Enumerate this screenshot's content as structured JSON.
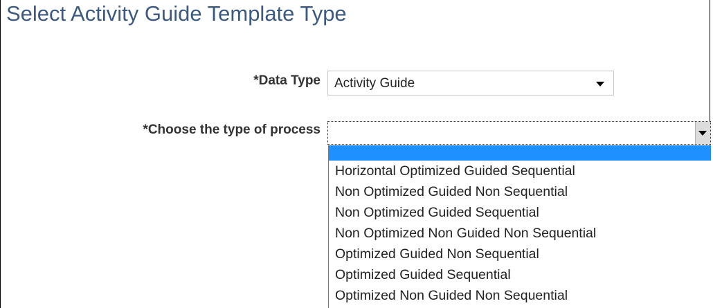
{
  "page": {
    "title": "Select Activity Guide Template Type"
  },
  "form": {
    "data_type": {
      "label": "*Data Type",
      "value": "Activity Guide"
    },
    "process_type": {
      "label": "*Choose the type of process",
      "value": "",
      "options": [
        "",
        "Horizontal Optimized Guided Sequential",
        "Non Optimized Guided Non Sequential",
        "Non Optimized Guided Sequential",
        "Non Optimized Non Guided Non Sequential",
        "Optimized Guided Non Sequential",
        "Optimized Guided Sequential",
        "Optimized Non Guided Non Sequential"
      ],
      "highlighted_index": 0
    }
  },
  "colors": {
    "title": "#3c5a80",
    "highlight": "#1e90ff"
  },
  "icons": {
    "dropdown": "chevron-down-icon"
  }
}
